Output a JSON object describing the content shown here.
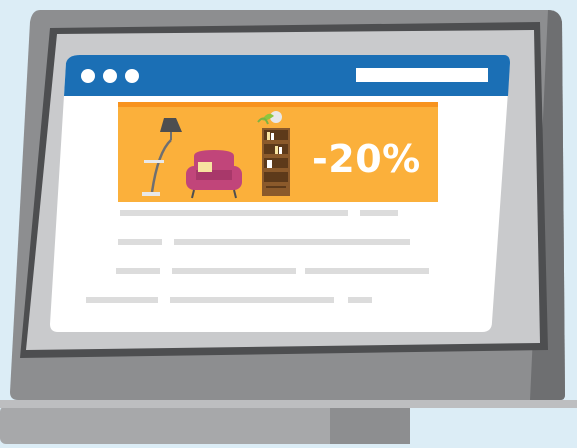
{
  "illustration": {
    "banner": {
      "discount_text": "-20%",
      "items": [
        "floor-lamp",
        "armchair",
        "bookshelf"
      ]
    },
    "colors": {
      "background": "#dcedf6",
      "monitor_body": "#8d8e90",
      "browser_titlebar": "#1b6fb5",
      "banner": "#fbb03b",
      "banner_stripe": "#f7931e",
      "armchair": "#c1457a",
      "bookshelf": "#8b5a2b",
      "placeholder_lines": "#dcdcdc"
    },
    "browser_controls": [
      "dot-1",
      "dot-2",
      "dot-3"
    ]
  }
}
